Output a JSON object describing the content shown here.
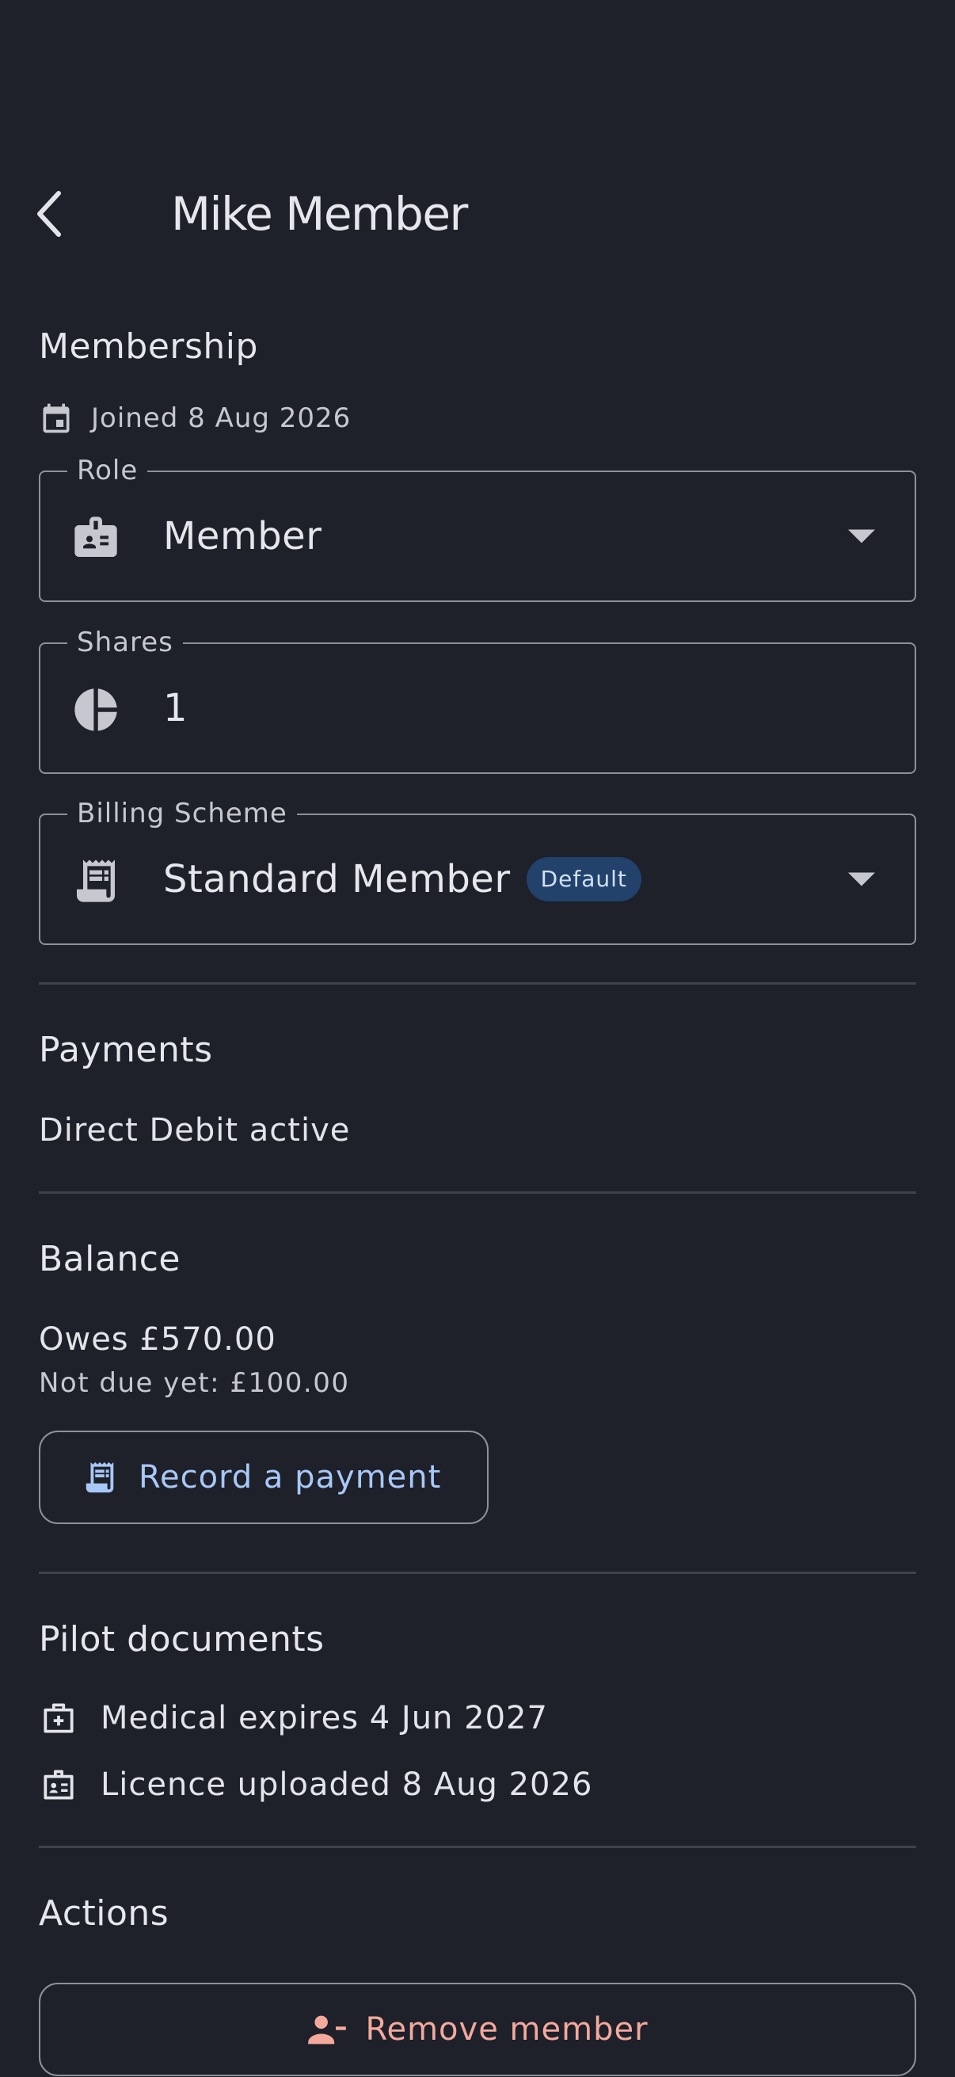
{
  "header": {
    "title": "Mike Member"
  },
  "membership": {
    "heading": "Membership",
    "joined": "Joined 8 Aug 2026",
    "role": {
      "label": "Role",
      "value": "Member"
    },
    "shares": {
      "label": "Shares",
      "value": "1"
    },
    "billing": {
      "label": "Billing Scheme",
      "value": "Standard Member",
      "badge": "Default"
    }
  },
  "payments": {
    "heading": "Payments",
    "status": "Direct Debit active"
  },
  "balance": {
    "heading": "Balance",
    "owes": "Owes £570.00",
    "not_due": "Not due yet: £100.00",
    "record_label": "Record a payment"
  },
  "documents": {
    "heading": "Pilot documents",
    "items": [
      {
        "icon": "medical-kit-icon",
        "text": "Medical expires 4 Jun 2027"
      },
      {
        "icon": "licence-badge-icon",
        "text": "Licence uploaded 8 Aug 2026"
      }
    ]
  },
  "actions": {
    "heading": "Actions",
    "remove_label": "Remove member"
  },
  "colors": {
    "background": "#1e202a",
    "accent_blue": "#a8c8f8",
    "danger": "#f3a99c",
    "badge_bg": "#22416b"
  }
}
